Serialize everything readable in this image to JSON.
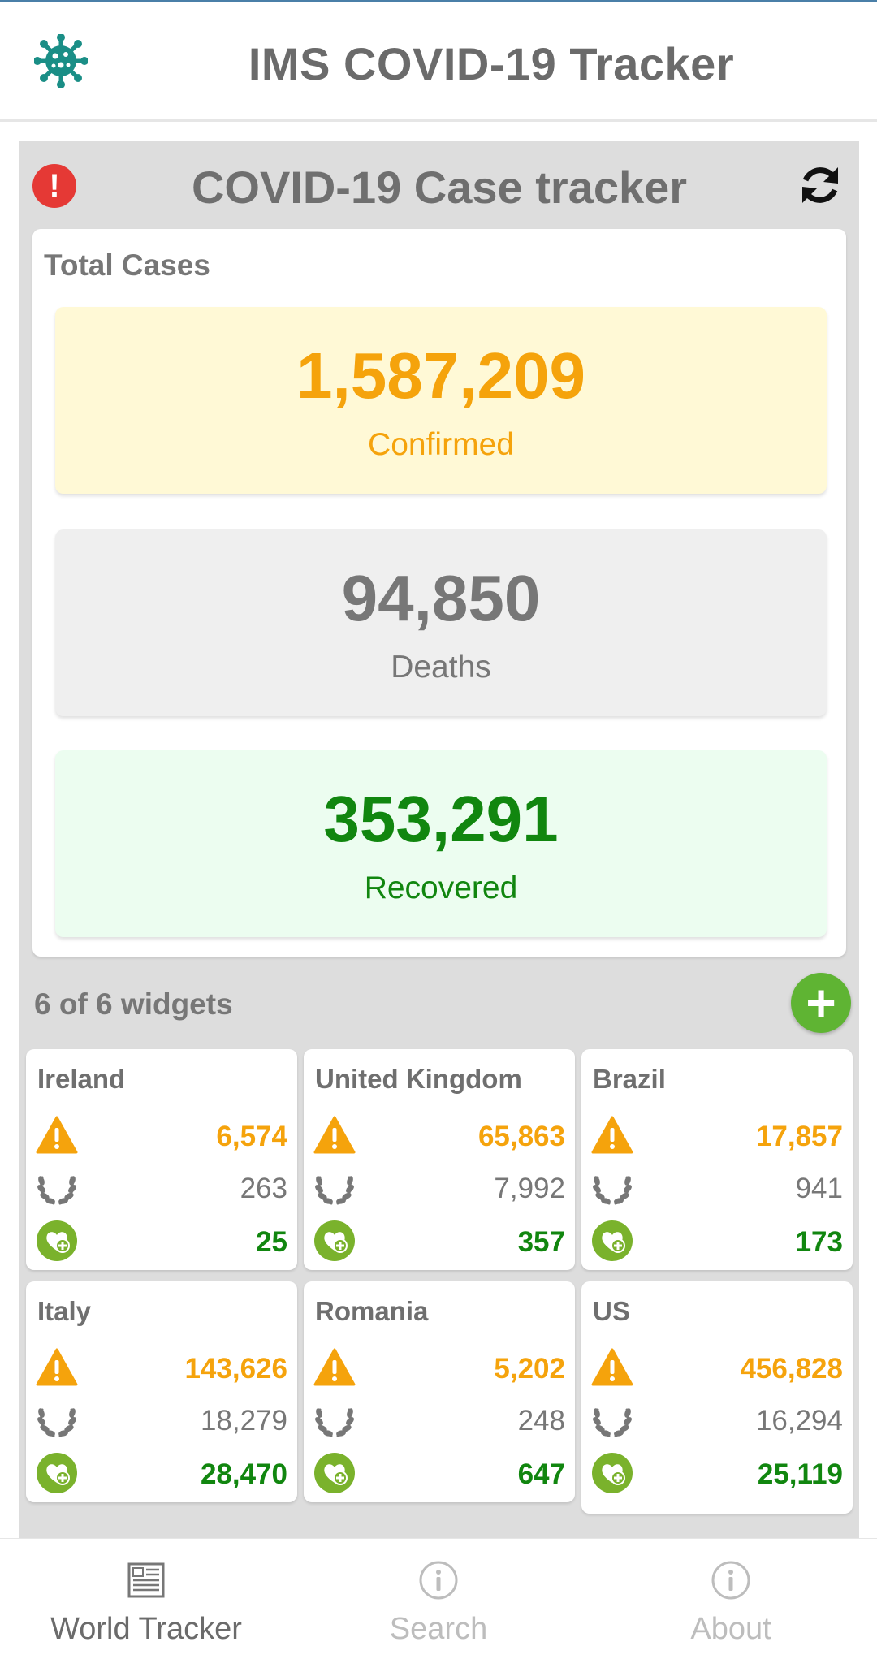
{
  "header": {
    "title": "IMS COVID-19 Tracker",
    "logo_icon": "virus-icon"
  },
  "tracker": {
    "title": "COVID-19 Case tracker",
    "alert_icon": "!",
    "refresh_icon": "refresh-icon"
  },
  "total": {
    "label": "Total Cases",
    "confirmed": {
      "value": "1,587,209",
      "label": "Confirmed"
    },
    "deaths": {
      "value": "94,850",
      "label": "Deaths"
    },
    "recovered": {
      "value": "353,291",
      "label": "Recovered"
    }
  },
  "widgets_label": "6 of 6 widgets",
  "add_label": "+",
  "widgets": [
    {
      "country": "Ireland",
      "confirmed": "6,574",
      "deaths": "263",
      "recovered": "25"
    },
    {
      "country": "United Kingdom",
      "confirmed": "65,863",
      "deaths": "7,992",
      "recovered": "357"
    },
    {
      "country": "Brazil",
      "confirmed": "17,857",
      "deaths": "941",
      "recovered": "173"
    },
    {
      "country": "Italy",
      "confirmed": "143,626",
      "deaths": "18,279",
      "recovered": "28,470"
    },
    {
      "country": "Romania",
      "confirmed": "5,202",
      "deaths": "248",
      "recovered": "647"
    },
    {
      "country": "US",
      "confirmed": "456,828",
      "deaths": "16,294",
      "recovered": "25,119"
    }
  ],
  "nav": [
    {
      "label": "World Tracker",
      "icon": "newspaper-icon",
      "active": true
    },
    {
      "label": "Search",
      "icon": "info-icon",
      "active": false
    },
    {
      "label": "About",
      "icon": "info-icon",
      "active": false
    }
  ],
  "colors": {
    "confirmed": "#f5a30c",
    "deaths": "#777777",
    "recovered": "#11860f",
    "alert": "#e53935",
    "add": "#5fb433"
  }
}
